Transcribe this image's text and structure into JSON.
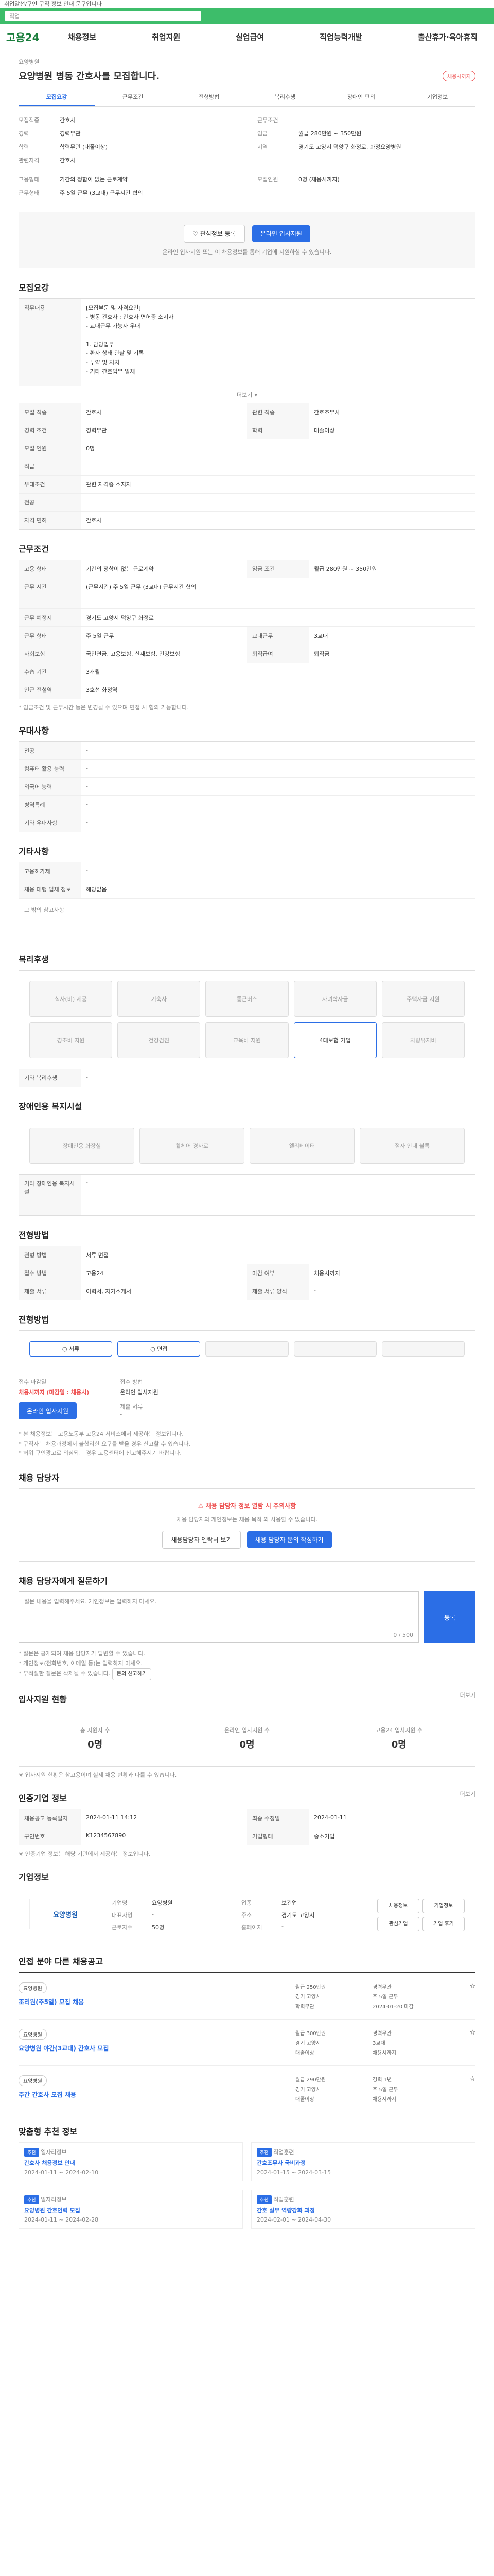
{
  "notice": "취업알선/구인 구직 정보 안내 문구입니다",
  "search_placeholder": "직업",
  "nav": {
    "logo": "고용24",
    "items": [
      "채용정보",
      "취업지원",
      "실업급여",
      "직업능력개발",
      "출산휴가·육아휴직"
    ]
  },
  "header": {
    "org": "요양병원",
    "title": "요양병원 병동 간호사를 모집합니다.",
    "tag": "채용시까지",
    "tabs": [
      "모집요강",
      "근무조건",
      "전형방법",
      "복리후생",
      "장애인 편의",
      "기업정보"
    ],
    "left_labels": [
      "모집직종",
      "경력",
      "학력",
      "관련자격"
    ],
    "left_vals": [
      "간호사",
      "경력무관",
      "학력무관 (대졸이상)",
      "간호사"
    ],
    "right_labels": [
      "근무조건",
      "임금",
      "지역"
    ],
    "right_vals": [
      "",
      "월급 280만원 ~ 350만원",
      "경기도 고양시 덕양구 화정로, 화정요양병원"
    ],
    "bottom_labels": [
      "고용형태",
      "근무형태"
    ],
    "bottom_vals": [
      "기간의 정함이 없는 근로계약",
      "주 5일 근무 (3교대) 근무시간 협의"
    ],
    "bottom_right_labels": [
      "모집인원"
    ],
    "bottom_right_vals": [
      "0명 (채용시까지)"
    ],
    "btn_save": "관심정보 등록",
    "btn_apply": "온라인 입사지원",
    "notice_text": "온라인 입사지원 또는 이 채용정보를 통해 기업에 지원하실 수 있습니다."
  },
  "recruit": {
    "title": "모집요강",
    "job_label": "직무내용",
    "job_text": [
      "[모집부문 및 자격요건]",
      "- 병동 간호사 : 간호사 면허증 소지자",
      "- 교대근무 가능자 우대",
      "",
      "1. 담당업무",
      "- 환자 상태 관찰 및 기록",
      "- 투약 및 처치",
      "- 기타 간호업무 일체"
    ],
    "toggle": "더보기",
    "rows": [
      [
        "모집 직종",
        "간호사",
        "관련 직종",
        "간호조무사"
      ],
      [
        "경력 조건",
        "경력무관",
        "학력",
        "대졸이상"
      ],
      [
        "모집 인원",
        "0명",
        "",
        ""
      ],
      [
        "직급",
        "",
        "",
        ""
      ],
      [
        "우대조건",
        "관련 자격증 소지자",
        "",
        ""
      ],
      [
        "전공",
        "",
        "",
        ""
      ],
      [
        "자격 면허",
        "간호사",
        "",
        ""
      ]
    ]
  },
  "work": {
    "title": "근무조건",
    "rows": [
      [
        "고용 형태",
        "기간의 정함이 없는 근로계약",
        "임금 조건",
        "월급 280만원 ~ 350만원"
      ],
      [
        "근무 시간",
        "(근무시간) 주 5일 근무 (3교대) 근무시간 협의",
        "",
        ""
      ],
      [
        "근무 예정지",
        "경기도 고양시 덕양구 화정로",
        "",
        ""
      ],
      [
        "근무 형태",
        "주 5일 근무",
        "교대근무",
        "3교대"
      ],
      [
        "사회보험",
        "국민연금, 고용보험, 산재보험, 건강보험",
        "퇴직급여",
        "퇴직금"
      ],
      [
        "수습 기간",
        "3개월",
        "",
        ""
      ],
      [
        "인근 전철역",
        "3호선 화정역",
        "",
        ""
      ]
    ],
    "foot": "* 임금조건 및 근무시간 등은 변경될 수 있으며 면접 시 협의 가능합니다."
  },
  "qual": {
    "title": "우대사항",
    "rows": [
      [
        "전공",
        "-"
      ],
      [
        "컴퓨터 활용 능력",
        "-"
      ],
      [
        "외국어 능력",
        "-"
      ],
      [
        "병역특례",
        "-"
      ],
      [
        "기타 우대사항",
        "-"
      ]
    ]
  },
  "extra": {
    "title": "기타사항",
    "rows": [
      [
        "고용허가제",
        "-"
      ],
      [
        "채용 대행 업체 정보",
        "해당없음"
      ]
    ],
    "note": "그 밖의 참고사항"
  },
  "welfare": {
    "title": "복리후생",
    "items": [
      "식사(비) 제공",
      "기숙사",
      "통근버스",
      "자녀학자금",
      "주택자금 지원",
      "경조비 지원",
      "건강검진",
      "교육비 지원",
      "차량유지비",
      "4대보험 가입"
    ],
    "note_label": "기타 복리후생",
    "note_val": "-"
  },
  "disability": {
    "title": "장애인용 복지시설",
    "items": [
      "장애인용 화장실",
      "휠체어 경사로",
      "엘리베이터",
      "점자 안내 블록"
    ],
    "label": "기타 장애인용 복지시설",
    "val": "-"
  },
  "process": {
    "title": "전형방법",
    "rows": [
      [
        "전형 방법",
        "서류 면접"
      ],
      [
        "접수 방법",
        "고용24"
      ],
      [
        "제출 서류",
        "이력서, 자기소개서"
      ]
    ],
    "right_labels": [
      "마감 여부",
      "제출 서류 양식"
    ],
    "right_vals": [
      "채용시까지",
      "-"
    ]
  },
  "apply_steps": {
    "title": "전형방법",
    "steps": [
      "서류",
      "면접",
      "",
      "",
      ""
    ]
  },
  "apply": {
    "left_label": "접수 마감일",
    "left_val": "채용시까지 (마감일 : 채용시)",
    "right_label": "접수 방법",
    "right_val": "온라인 입사지원",
    "apply_btn": "온라인 입사지원",
    "doc_label": "제출 서류",
    "doc_val": "-",
    "notes": [
      "* 본 채용정보는 고용노동부 고용24 서비스에서 제공하는 정보입니다.",
      "* 구직자는 채용과정에서 불합리한 요구를 받을 경우 신고할 수 있습니다.",
      "* 허위 구인광고로 의심되는 경우 고용센터에 신고해주시기 바랍니다."
    ]
  },
  "contact": {
    "title": "채용 담당자",
    "warn": "채용 담당자 정보 열람 시 주의사항",
    "desc": "채용 담당자의 개인정보는 채용 목적 외 사용할 수 없습니다.",
    "btn1": "채용담당자 연락처 보기",
    "btn2": "채용 담당자 문의 작성하기"
  },
  "qna": {
    "title": "채용 담당자에게 질문하기",
    "placeholder": "질문 내용을 입력해주세요. 개인정보는 입력하지 마세요.",
    "count": "0 / 500",
    "submit": "등록",
    "notes": [
      "* 질문은 공개되며 채용 담당자가 답변할 수 있습니다.",
      "* 개인정보(전화번호, 이메일 등)는 입력하지 마세요.",
      "* 부적절한 질문은 삭제될 수 있습니다."
    ],
    "report_btn": "문의 신고하기"
  },
  "stats": {
    "title": "입사지원 현황",
    "more": "더보기",
    "items": [
      [
        "총 지원자 수",
        "0명"
      ],
      [
        "온라인 입사지원 수",
        "0명"
      ],
      [
        "고용24 입사지원 수",
        "0명"
      ]
    ],
    "note": "※ 입사지원 현황은 참고용이며 실제 채용 현황과 다를 수 있습니다."
  },
  "info": {
    "title": "인증기업 정보",
    "badge": "더보기",
    "rows": [
      [
        "채용공고 등록일자",
        "2024-01-11 14:12",
        "최종 수정일",
        "2024-01-11"
      ],
      [
        "구인번호",
        "K1234567890",
        "기업형태",
        "중소기업"
      ]
    ],
    "note": "※ 인증기업 정보는 해당 기관에서 제공하는 정보입니다."
  },
  "company": {
    "title": "기업정보",
    "name": "요양병원",
    "labels": [
      "기업명",
      "업종",
      "대표자명",
      "주소",
      "근로자수",
      "홈페이지"
    ],
    "vals": [
      "요양병원",
      "보건업",
      "-",
      "경기도 고양시",
      "50명",
      "-"
    ],
    "side_btns": [
      "채용정보",
      "기업정보",
      "관심기업",
      "기업 후기"
    ]
  },
  "related": {
    "title": "인접 분야 다른 채용공고",
    "jobs": [
      {
        "badge": "요양병원",
        "title": "조리원(주5일) 모집 채용",
        "meta": [
          "월급 250만원",
          "경력무관",
          "경기 고양시",
          "주 5일 근무",
          "학력무관",
          "2024-01-20 마감"
        ]
      },
      {
        "badge": "요양병원",
        "title": "요양병원 야간(3교대) 간호사 모집",
        "meta": [
          "월급 300만원",
          "경력무관",
          "경기 고양시",
          "3교대",
          "대졸이상",
          "채용시까지"
        ]
      },
      {
        "badge": "요양병원",
        "title": "주간 간호사 모집 채용",
        "meta": [
          "월급 290만원",
          "경력 1년",
          "경기 고양시",
          "주 5일 근무",
          "대졸이상",
          "채용시까지"
        ]
      }
    ]
  },
  "recommend": {
    "title": "맞춤형 추천 정보",
    "cards": [
      {
        "chip": "추천",
        "org": "일자리정보",
        "t": "간호사 채용정보 안내",
        "d": "2024-01-11 ~ 2024-02-10"
      },
      {
        "chip": "추천",
        "org": "직업훈련",
        "t": "간호조무사 국비과정",
        "d": "2024-01-15 ~ 2024-03-15"
      },
      {
        "chip": "추천",
        "org": "일자리정보",
        "t": "요양병원 간호인력 모집",
        "d": "2024-01-11 ~ 2024-02-28"
      },
      {
        "chip": "추천",
        "org": "직업훈련",
        "t": "간호 실무 역량강화 과정",
        "d": "2024-02-01 ~ 2024-04-30"
      }
    ]
  }
}
